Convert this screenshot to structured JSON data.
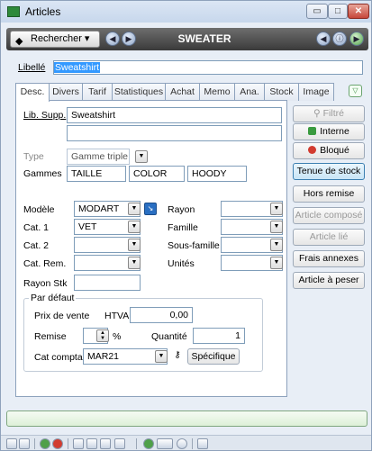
{
  "window": {
    "title": "Articles",
    "controls": {
      "min": "▭",
      "max": "□",
      "close": "✕"
    }
  },
  "toolbar": {
    "search_label": "Rechercher",
    "search_arrow": "▾",
    "record_title": "SWEATER",
    "nav_glyphs": [
      "◀",
      "▶",
      "◀",
      "ⓘ",
      "▶"
    ]
  },
  "libelle": {
    "label": "Libellé",
    "value": "Sweatshirt"
  },
  "tabs": [
    {
      "label": "Desc.",
      "active": true
    },
    {
      "label": "Divers"
    },
    {
      "label": "Tarif"
    },
    {
      "label": "Statistiques"
    },
    {
      "label": "Achat"
    },
    {
      "label": "Memo"
    },
    {
      "label": "Ana."
    },
    {
      "label": "Stock"
    },
    {
      "label": "Image"
    }
  ],
  "desc": {
    "lib_supp": {
      "label": "Lib. Supp.",
      "value": "Sweatshirt",
      "value2": ""
    },
    "type": {
      "label": "Type",
      "value": "Gamme triple"
    },
    "gammes": {
      "label": "Gammes",
      "values": [
        "TAILLE",
        "COLOR",
        "HOODY"
      ]
    },
    "modele": {
      "label": "Modèle",
      "value": "MODART"
    },
    "cat1": {
      "label": "Cat. 1",
      "value": "VET"
    },
    "cat2": {
      "label": "Cat. 2",
      "value": ""
    },
    "cat_rem": {
      "label": "Cat. Rem.",
      "value": ""
    },
    "rayon_stk": {
      "label": "Rayon Stk",
      "value": ""
    },
    "rayon": {
      "label": "Rayon",
      "value": ""
    },
    "famille": {
      "label": "Famille",
      "value": ""
    },
    "sous_famille": {
      "label": "Sous-famille",
      "value": ""
    },
    "unites": {
      "label": "Unités",
      "value": ""
    },
    "defaut": {
      "legend": "Par défaut",
      "prix_label": "Prix de vente",
      "htva_label": "HTVA",
      "prix_value": "0,00",
      "remise_label": "Remise",
      "remise_value": "",
      "percent": "%",
      "quantite_label": "Quantité",
      "quantite_value": "1",
      "cat_compta_label": "Cat compta",
      "cat_compta_value": "MAR21",
      "specifique_label": "Spécifique"
    }
  },
  "side_buttons": [
    "Filtré",
    "Interne",
    "Bloqué",
    "Tenue de stock",
    "Hors remise",
    "Article composé",
    "Article lié",
    "Frais annexes",
    "Article à peser"
  ],
  "colors": {
    "interne": "#3a9b3f",
    "bloque": "#d23b2f",
    "selected_border": "#3c7fb1"
  }
}
